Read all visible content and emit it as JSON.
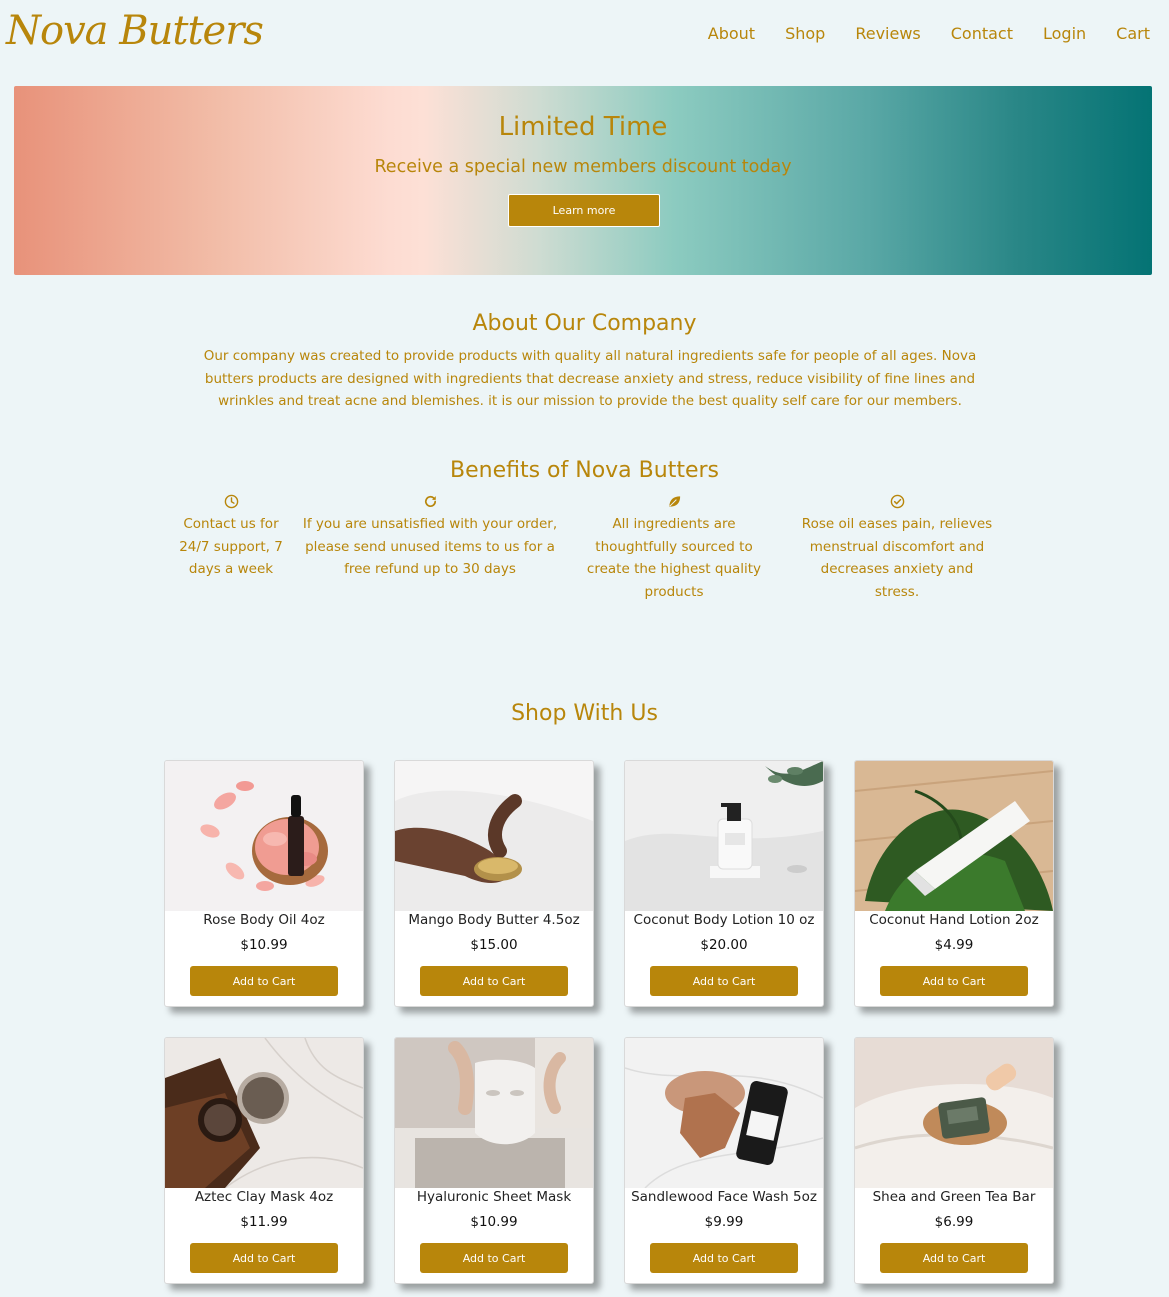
{
  "header": {
    "brand": "Nova Butters",
    "nav": [
      "About",
      "Shop",
      "Reviews",
      "Contact",
      "Login",
      "Cart"
    ]
  },
  "banner": {
    "title": "Limited Time",
    "subtitle": "Receive a special new members discount today",
    "button": "Learn more"
  },
  "about": {
    "title": "About Our Company",
    "text": "Our company was created to provide products with quality all natural ingredients safe for people of all ages. Nova butters products are designed with ingredients that decrease anxiety and stress, reduce visibility of fine lines and wrinkles and treat acne and blemishes. it is our mission to provide the best quality self care for our members."
  },
  "benefits": {
    "title": "Benefits of Nova Butters",
    "items": [
      {
        "icon": "clock-icon",
        "text": "Contact us for 24/7 support, 7 days a week"
      },
      {
        "icon": "refresh-icon",
        "text": "If you are unsatisfied with your order, please send unused items to us for a free refund up to 30 days"
      },
      {
        "icon": "leaf-icon",
        "text": "All ingredients are thoughtfully sourced to create the highest quality products"
      },
      {
        "icon": "check-circle-icon",
        "text": "Rose oil eases pain, relieves menstrual discomfort and decreases anxiety and stress."
      }
    ]
  },
  "shop": {
    "title": "Shop With Us",
    "button_label": "Add to Cart",
    "products": [
      {
        "name": "Rose Body Oil 4oz",
        "price": "$10.99"
      },
      {
        "name": "Mango Body Butter 4.5oz",
        "price": "$15.00"
      },
      {
        "name": "Coconut Body Lotion 10 oz",
        "price": "$20.00"
      },
      {
        "name": "Coconut Hand Lotion 2oz",
        "price": "$4.99"
      },
      {
        "name": "Aztec Clay Mask 4oz",
        "price": "$11.99"
      },
      {
        "name": "Hyaluronic Sheet Mask",
        "price": "$10.99"
      },
      {
        "name": "Sandlewood Face Wash 5oz",
        "price": "$9.99"
      },
      {
        "name": "Shea and Green Tea Bar",
        "price": "$6.99"
      }
    ]
  },
  "colors": {
    "accent": "#b8860b",
    "background": "#edf5f7"
  }
}
